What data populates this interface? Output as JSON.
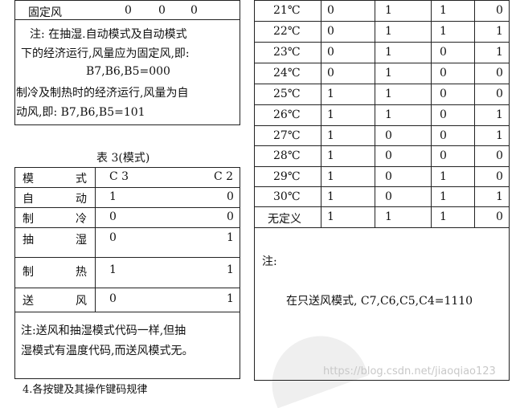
{
  "left_top": {
    "row_label": "固定风",
    "row_values": [
      "0",
      "0",
      "0"
    ],
    "note_lines": [
      "注:  在抽湿.自动模式及自动模式",
      "下的经济运行,风量应为固定风,即:",
      "B7,B6,B5=000",
      "制冷及制热时的经济运行,风量为自",
      "动风,即:  B7,B6,B5=101"
    ]
  },
  "mode_table": {
    "caption": "表 3(模式)",
    "header": {
      "col0": [
        "模",
        "式"
      ],
      "c3": "C 3",
      "c2": "C 2"
    },
    "rows": [
      {
        "name": [
          "自",
          "动"
        ],
        "c3": "1",
        "c2": "0"
      },
      {
        "name": [
          "制",
          "冷"
        ],
        "c3": "0",
        "c2": "0"
      },
      {
        "name": [
          "抽",
          "湿"
        ],
        "c3": "0",
        "c2": "1"
      },
      {
        "name": [
          "制",
          "热"
        ],
        "c3": "1",
        "c2": "1"
      },
      {
        "name": [
          "送",
          "风"
        ],
        "c3": "0",
        "c2": "1"
      }
    ],
    "note_lines": [
      "注:送风和抽湿模式代码一样,但抽",
      "湿模式有温度代码,而送风模式无。"
    ]
  },
  "temp_table": {
    "rows": [
      {
        "label": "21℃",
        "v": [
          "0",
          "1",
          "1",
          "0"
        ]
      },
      {
        "label": "22℃",
        "v": [
          "0",
          "1",
          "1",
          "1"
        ]
      },
      {
        "label": "23℃",
        "v": [
          "0",
          "1",
          "0",
          "1"
        ]
      },
      {
        "label": "24℃",
        "v": [
          "0",
          "1",
          "0",
          "0"
        ]
      },
      {
        "label": "25℃",
        "v": [
          "1",
          "1",
          "0",
          "0"
        ]
      },
      {
        "label": "26℃",
        "v": [
          "1",
          "1",
          "0",
          "1"
        ]
      },
      {
        "label": "27℃",
        "v": [
          "1",
          "0",
          "0",
          "1"
        ]
      },
      {
        "label": "28℃",
        "v": [
          "1",
          "0",
          "0",
          "0"
        ]
      },
      {
        "label": "29℃",
        "v": [
          "1",
          "0",
          "1",
          "0"
        ]
      },
      {
        "label": "30℃",
        "v": [
          "1",
          "0",
          "1",
          "1"
        ]
      },
      {
        "label": "无定义",
        "v": [
          "1",
          "1",
          "1",
          "0"
        ]
      }
    ],
    "note_label": "注:",
    "note_text": "在只送风模式, C7,C6,C5,C4=1110"
  },
  "bottom_fragment": "4.各按键及其操作键码规律",
  "watermark": "https://blog.csdn.net/jiaoqiao123"
}
